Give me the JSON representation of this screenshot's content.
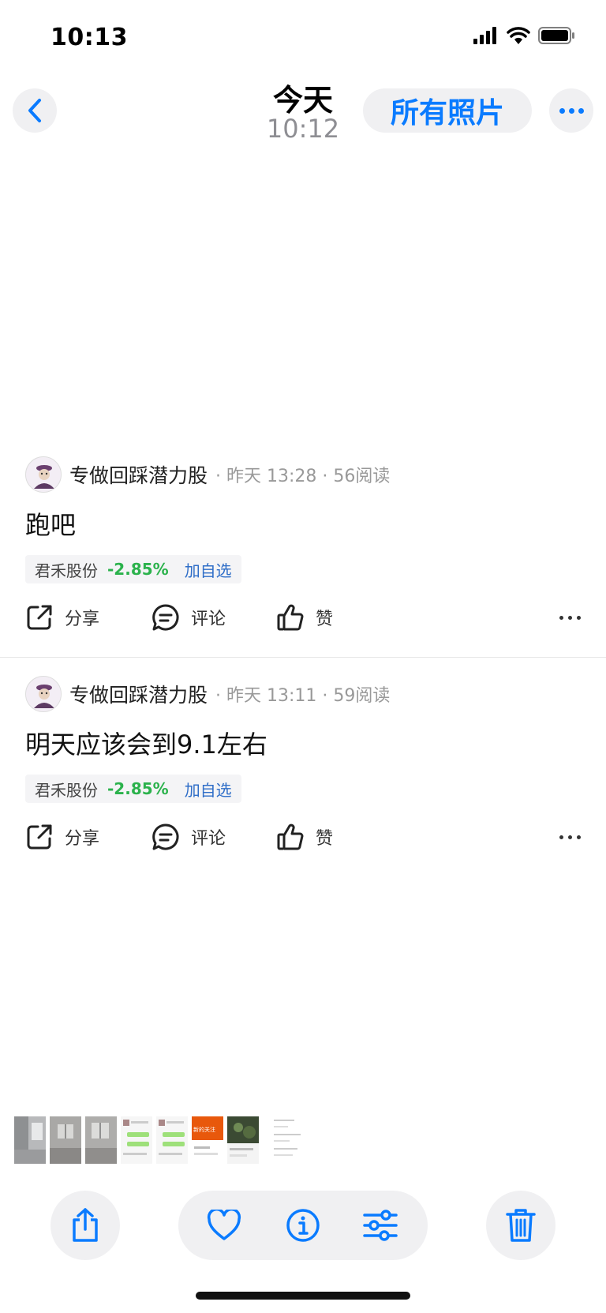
{
  "status_bar": {
    "time": "10:13"
  },
  "nav": {
    "title": "今天",
    "subtitle": "10:12",
    "all_photos_label": "所有照片"
  },
  "posts": [
    {
      "author": "专做回踩潜力股",
      "meta": "· 昨天 13:28 · 56阅读",
      "text": "跑吧",
      "stock": {
        "name": "君禾股份",
        "change": "-2.85%",
        "add_label": "加自选"
      },
      "actions": {
        "share": "分享",
        "comment": "评论",
        "like": "赞"
      }
    },
    {
      "author": "专做回踩潜力股",
      "meta": "· 昨天 13:11 · 59阅读",
      "text": "明天应该会到9.1左右",
      "stock": {
        "name": "君禾股份",
        "change": "-2.85%",
        "add_label": "加自选"
      },
      "actions": {
        "share": "分享",
        "comment": "评论",
        "like": "赞"
      }
    }
  ],
  "thumbnails": [
    {
      "kind": "room-photo",
      "label": ""
    },
    {
      "kind": "room-photo",
      "label": ""
    },
    {
      "kind": "room-photo",
      "label": ""
    },
    {
      "kind": "chat-screenshot",
      "label": ""
    },
    {
      "kind": "chat-screenshot",
      "label": ""
    },
    {
      "kind": "orange-screenshot",
      "label": "新的关注"
    },
    {
      "kind": "dark-screenshot",
      "label": ""
    },
    {
      "kind": "post-screenshot",
      "label": ""
    }
  ],
  "colors": {
    "accent": "#0a7bff",
    "stock_down": "#2bb24c",
    "link_blue": "#2f6ec8"
  },
  "icons": [
    "back-chevron-icon",
    "more-dots-icon",
    "share-icon",
    "comment-icon",
    "like-icon",
    "heart-icon",
    "info-icon",
    "adjust-icon",
    "trash-icon"
  ]
}
